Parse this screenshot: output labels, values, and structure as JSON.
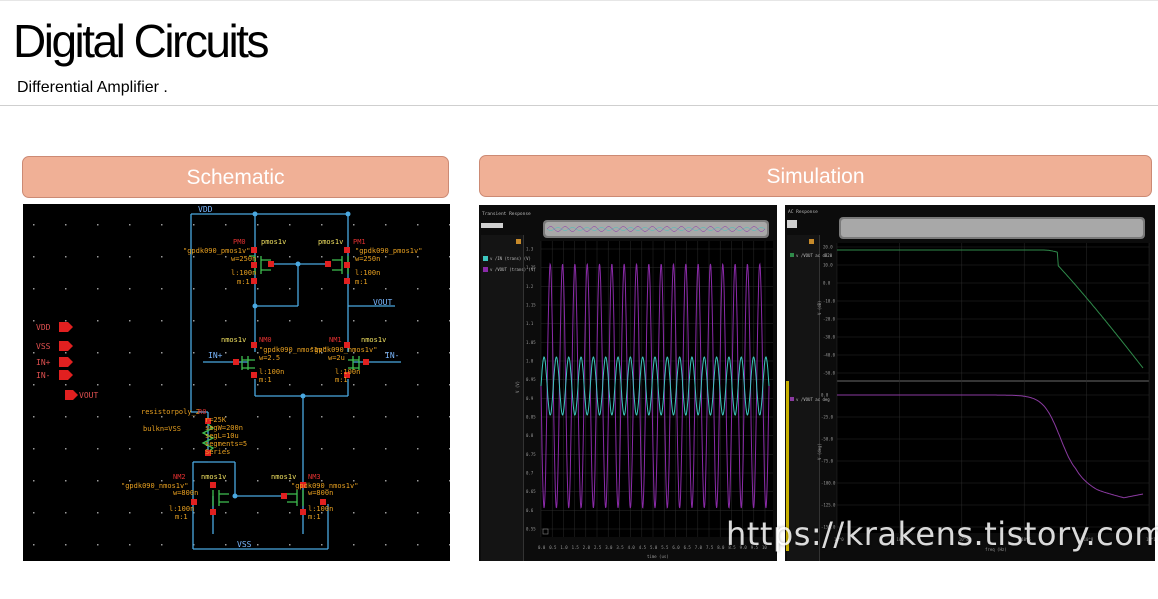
{
  "header": {
    "title": "Digital Circuits",
    "subtitle": "Differential Amplifier ."
  },
  "sections": {
    "schematic_label": "Schematic",
    "simulation_label": "Simulation"
  },
  "schematic": {
    "vdd": "VDD",
    "vss": "VSS",
    "vout": "VOUT",
    "in_plus": "IN+",
    "in_minus": "IN-",
    "pins": [
      "VDD",
      "VSS",
      "IN+",
      "IN-",
      "VOUT"
    ],
    "pm0": {
      "name": "PM0",
      "type": "pmos1v",
      "model": "\"gpdk090_pmos1v\"",
      "w": "w=250n",
      "l": "l:100n",
      "m": "m:1"
    },
    "pm1": {
      "name": "PM1",
      "type": "pmos1v",
      "model": "\"gpdk090_pmos1v\"",
      "w": "w=250n",
      "l": "l:100n",
      "m": "m:1"
    },
    "nm0": {
      "name": "NM0",
      "type": "nmos1v",
      "model": "\"gpdk090_nmos1v\"",
      "w": "w=2.5",
      "l": "l:100n",
      "m": "m:1"
    },
    "nm1": {
      "name": "NM1",
      "type": "nmos1v",
      "model": "\"gpdk090_nmos1v\"",
      "w": "w=2u",
      "l": "l:100n",
      "m": "m:1"
    },
    "nm2": {
      "name": "NM2",
      "type": "nmos1v",
      "model": "\"gpdk090_nmos1v\"",
      "w": "w=800n",
      "l": "l:100n",
      "m": "m:1"
    },
    "nm3": {
      "name": "NM3",
      "type": "nmos1v",
      "model": "\"gpdk090_nmos1v\"",
      "w": "w=800n",
      "l": "l:100n",
      "m": "m:1"
    },
    "r0": {
      "cell": "resistorpoly_2",
      "name": "R0",
      "r": "r=25K",
      "bulk": "bulkn=VSS",
      "segw": "segW=200n",
      "segl": "segL=10u",
      "segments": "segments=5",
      "mode": "Series"
    }
  },
  "transient": {
    "title": "Transient Response",
    "legend": [
      "v /IN (trans) (V)",
      "v /VOUT (trans) (V)"
    ],
    "yaxis_label": "V (V)",
    "xaxis_label": "time (us)",
    "yticks": [
      "1.3",
      "1.25",
      "1.2",
      "1.15",
      "1.1",
      "1.05",
      "1.0",
      "0.95",
      "0.9",
      "0.85",
      "0.8",
      "0.75",
      "0.7",
      "0.65",
      "0.6",
      "0.55"
    ],
    "xticks": [
      "0.0",
      "0.5",
      "1.0",
      "1.5",
      "2.0",
      "2.5",
      "3.0",
      "3.5",
      "4.0",
      "4.5",
      "5.0",
      "5.5",
      "6.0",
      "6.5",
      "7.0",
      "7.5",
      "8.0",
      "8.5",
      "9.0",
      "9.5",
      "10"
    ],
    "colors": {
      "in": "#3ec6bf",
      "vout": "#8a2aa8"
    }
  },
  "ac": {
    "title": "AC Response",
    "legend_mag": "v /VOUT ac dB20",
    "legend_phase": "v /VOUT ac deg",
    "yaxis_mag": "V (dB)",
    "yaxis_phase": "V (deg)",
    "xaxis_label": "freq (Hz)",
    "mag_ticks": [
      "20.0",
      "10.0",
      "0.0",
      "-10.0",
      "-20.0",
      "-30.0",
      "-40.0",
      "-50.0"
    ],
    "phase_ticks": [
      "0.0",
      "-25.0",
      "-50.0",
      "-75.0",
      "-100.0",
      "-125.0",
      "-150.0"
    ],
    "xticks": [
      "10^0",
      "10^2",
      "10^4",
      "10^6",
      "10^8",
      "10^10"
    ],
    "colors": {
      "mag": "#2f8a4a",
      "phase": "#8a3aa0"
    }
  },
  "watermark": "https://krakens.tistory.com"
}
